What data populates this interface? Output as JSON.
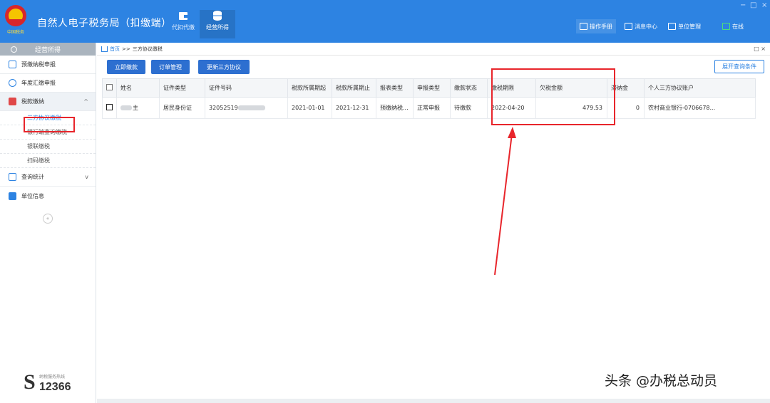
{
  "app": {
    "title": "自然人电子税务局（扣缴端）",
    "modules": [
      {
        "label": "代扣代缴"
      },
      {
        "label": "经营所得"
      }
    ],
    "top_right": {
      "manual": "操作手册",
      "messages": "消息中心",
      "unit_manage": "单位管理",
      "online": "在线"
    },
    "window_controls": [
      "−",
      "□",
      "×"
    ]
  },
  "sidebar": {
    "header": "经营所得",
    "items": [
      {
        "label": "预缴纳税申报",
        "icon": "document-icon"
      },
      {
        "label": "年度汇缴申报",
        "icon": "clock-icon"
      },
      {
        "label": "税款缴纳",
        "icon": "payment-icon",
        "chevron": "^",
        "children": [
          {
            "label": "三方协议缴税"
          },
          {
            "label": "银行端查询缴税"
          },
          {
            "label": "银联缴税"
          },
          {
            "label": "扫码缴税"
          }
        ]
      },
      {
        "label": "查询统计",
        "icon": "stats-icon",
        "chevron": "v"
      },
      {
        "label": "单位信息",
        "icon": "info-icon"
      }
    ],
    "collapse": "«",
    "hotline": {
      "label": "纳税服务热线",
      "number": "12366"
    }
  },
  "main": {
    "breadcrumb": {
      "home": "首页",
      "sep": ">>",
      "current": "三方协议缴税"
    },
    "panel_controls": "□ ×",
    "toolbar": {
      "pay_now": "立即缴款",
      "order_manage": "订单管理",
      "update_agreement": "更新三方协议",
      "expand_query": "展开查询条件"
    },
    "table": {
      "columns": [
        "",
        "姓名",
        "证件类型",
        "证件号码",
        "税款所属期起",
        "税款所属期止",
        "报表类型",
        "申报类型",
        "缴款状态",
        "缴税期限",
        "欠税金额",
        "滞纳金",
        "个人三方协议账户"
      ],
      "rows": [
        {
          "name_suffix": "主",
          "id_type": "居民身份证",
          "id_number_prefix": "32052519",
          "period_start": "2021-01-01",
          "period_end": "2021-12-31",
          "report_type": "预缴纳税...",
          "declare_type": "正常申报",
          "pay_status": "待缴款",
          "deadline": "2022-04-20",
          "amount_owed": "479.53",
          "late_fee": "0",
          "account": "农村商业银行-0706678..."
        }
      ]
    }
  },
  "watermark": "头条 @办税总动员",
  "colors": {
    "topbar": "#2d83e2",
    "button": "#2d6fd0",
    "annotation": "#e8252b"
  }
}
